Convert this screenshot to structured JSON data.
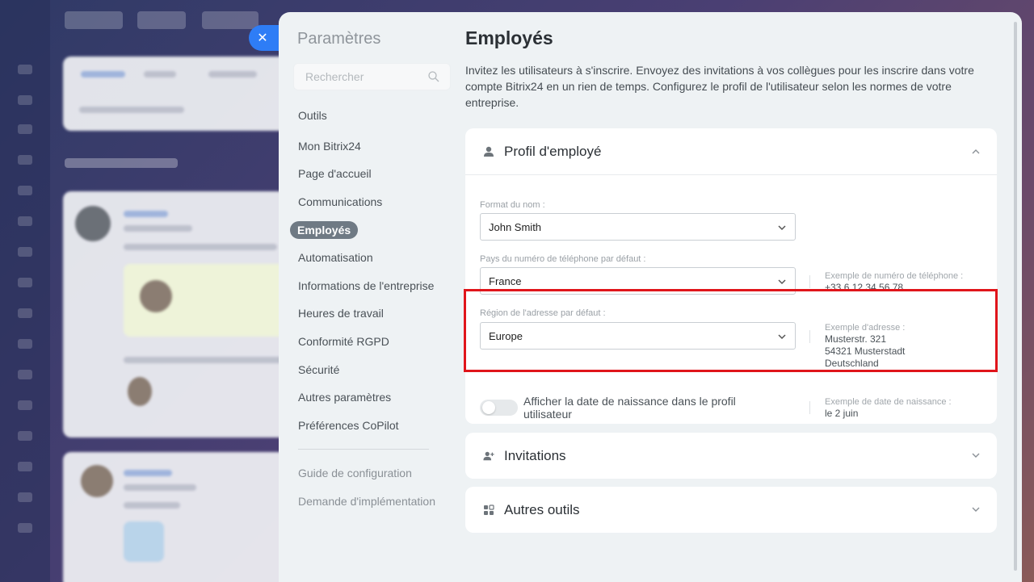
{
  "close_icon": "close-icon",
  "sidebar": {
    "title": "Paramètres",
    "search_placeholder": "Rechercher",
    "items": [
      {
        "label": "Outils"
      },
      {
        "label": "Mon Bitrix24"
      },
      {
        "label": "Page d'accueil"
      },
      {
        "label": "Communications"
      },
      {
        "label": "Employés",
        "active": true
      },
      {
        "label": "Automatisation"
      },
      {
        "label": "Informations de l'entreprise"
      },
      {
        "label": "Heures de travail"
      },
      {
        "label": "Conformité RGPD"
      },
      {
        "label": "Sécurité"
      },
      {
        "label": "Autres paramètres"
      },
      {
        "label": "Préférences CoPilot"
      }
    ],
    "footer": [
      {
        "label": "Guide de configuration"
      },
      {
        "label": "Demande d'implémentation"
      }
    ]
  },
  "main": {
    "title": "Employés",
    "description": "Invitez les utilisateurs à s'inscrire. Envoyez des invitations à vos collègues pour les inscrire dans votre compte Bitrix24 en un rien de temps. Configurez le profil de l'utilisateur selon les normes de votre entreprise.",
    "profile": {
      "title": "Profil d'employé",
      "icon": "person-icon",
      "name_format": {
        "label": "Format du nom :",
        "value": "John Smith"
      },
      "phone_country": {
        "label": "Pays du numéro de téléphone par défaut :",
        "value": "France",
        "example_label": "Exemple de numéro de téléphone :",
        "example_value": "+33 6 12 34 56 78"
      },
      "address_region": {
        "label": "Région de l'adresse par défaut :",
        "value": "Europe",
        "example_label": "Exemple d'adresse :",
        "example_lines": [
          "Musterstr. 321",
          "54321 Musterstadt",
          "Deutschland"
        ]
      },
      "birthday": {
        "label": "Afficher la date de naissance dans le profil utilisateur",
        "enabled": false,
        "example_label": "Exemple de date de naissance :",
        "example_value": "le 2 juin"
      }
    },
    "invitations": {
      "title": "Invitations",
      "icon": "add-user-icon"
    },
    "other_tools": {
      "title": "Autres outils",
      "icon": "grid-icon"
    }
  },
  "colors": {
    "accent": "#2e7df6",
    "highlight": "#e0151b",
    "active_nav": "#6f7a84"
  }
}
